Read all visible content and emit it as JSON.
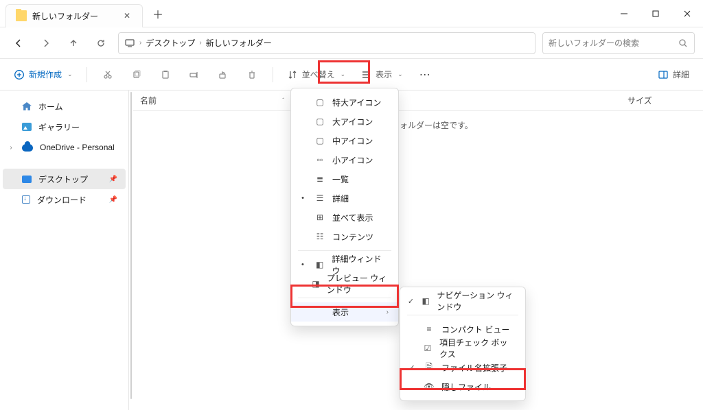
{
  "tab": {
    "title": "新しいフォルダー"
  },
  "nav": {
    "breadcrumb": [
      "デスクトップ",
      "新しいフォルダー"
    ],
    "search_placeholder": "新しいフォルダーの検索"
  },
  "toolbar": {
    "new": "新規作成",
    "sort": "並べ替え",
    "view": "表示",
    "details": "詳細"
  },
  "sidebar": {
    "home": "ホーム",
    "gallery": "ギャラリー",
    "onedrive": "OneDrive - Personal",
    "desktop": "デスクトップ",
    "downloads": "ダウンロード"
  },
  "columns": {
    "name": "名前",
    "size": "サイズ"
  },
  "empty": "ォルダーは空です。",
  "view_menu": {
    "extra_large": "特大アイコン",
    "large": "大アイコン",
    "medium": "中アイコン",
    "small": "小アイコン",
    "list": "一覧",
    "details": "詳細",
    "tiles": "並べて表示",
    "content": "コンテンツ",
    "details_pane": "詳細ウィンドウ",
    "preview_pane": "プレビュー ウィンドウ",
    "show": "表示"
  },
  "show_menu": {
    "navigation_pane": "ナビゲーション ウィンドウ",
    "compact_view": "コンパクト ビュー",
    "item_checkboxes": "項目チェック ボックス",
    "file_extensions": "ファイル名拡張子",
    "hidden_items": "隠しファイル"
  }
}
